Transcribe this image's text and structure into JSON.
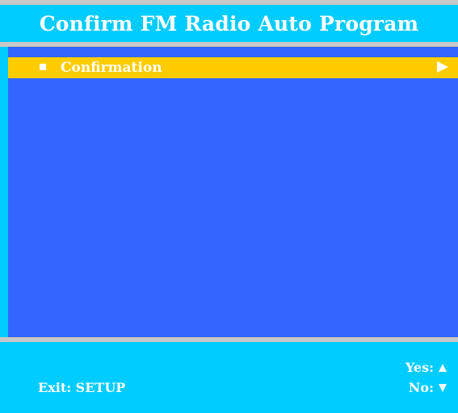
{
  "header": {
    "title": "Confirm FM Radio Auto Program"
  },
  "menu": {
    "items": [
      {
        "label": "Confirmation",
        "selected": true,
        "icon": "square-bullet-icon",
        "trailing_icon": "right-arrow-icon"
      }
    ]
  },
  "footer": {
    "exit_label": "Exit: SETUP",
    "yes_label": "Yes:",
    "yes_icon": "up-triangle-icon",
    "no_label": "No:",
    "no_icon": "down-triangle-icon"
  },
  "colors": {
    "header_bg": "#00ccff",
    "main_bg": "#3366ff",
    "highlight": "#ffcc00",
    "divider": "#c8c8c8",
    "text": "#ffffff"
  }
}
